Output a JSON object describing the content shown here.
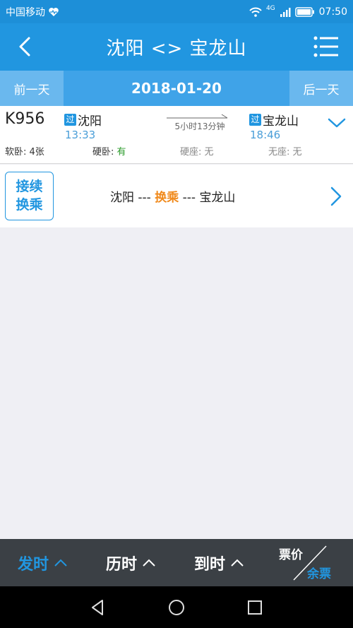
{
  "status": {
    "carrier": "中国移动",
    "network": "4G",
    "time": "07:50"
  },
  "header": {
    "title": "沈阳 <> 宝龙山"
  },
  "date_bar": {
    "prev_label": "前一天",
    "date": "2018-01-20",
    "next_label": "后一天"
  },
  "train": {
    "number": "K956",
    "pass_badge": "过",
    "from_station": "沈阳",
    "to_station": "宝龙山",
    "depart_time": "13:33",
    "arrive_time": "18:46",
    "duration": "5小时13分钟",
    "seats": [
      {
        "label": "软卧: ",
        "value": "4张"
      },
      {
        "label": "硬卧: ",
        "value": "有"
      },
      {
        "label": "硬座: ",
        "value": "无"
      },
      {
        "label": "无座: ",
        "value": "无"
      }
    ]
  },
  "transfer": {
    "badge_line1": "接续",
    "badge_line2": "换乘",
    "from": "沈阳",
    "sep1": " --- ",
    "middle": "换乘",
    "sep2": " --- ",
    "to": "宝龙山"
  },
  "sort_bar": {
    "depart_label": "发时",
    "duration_label": "历时",
    "arrive_label": "到时",
    "price_label": "票价",
    "remaining_label": "余票"
  },
  "colors": {
    "primary": "#2196e0",
    "available": "#2a9a2a",
    "highlight": "#f0891a",
    "sortbar_bg": "#3b4045"
  }
}
